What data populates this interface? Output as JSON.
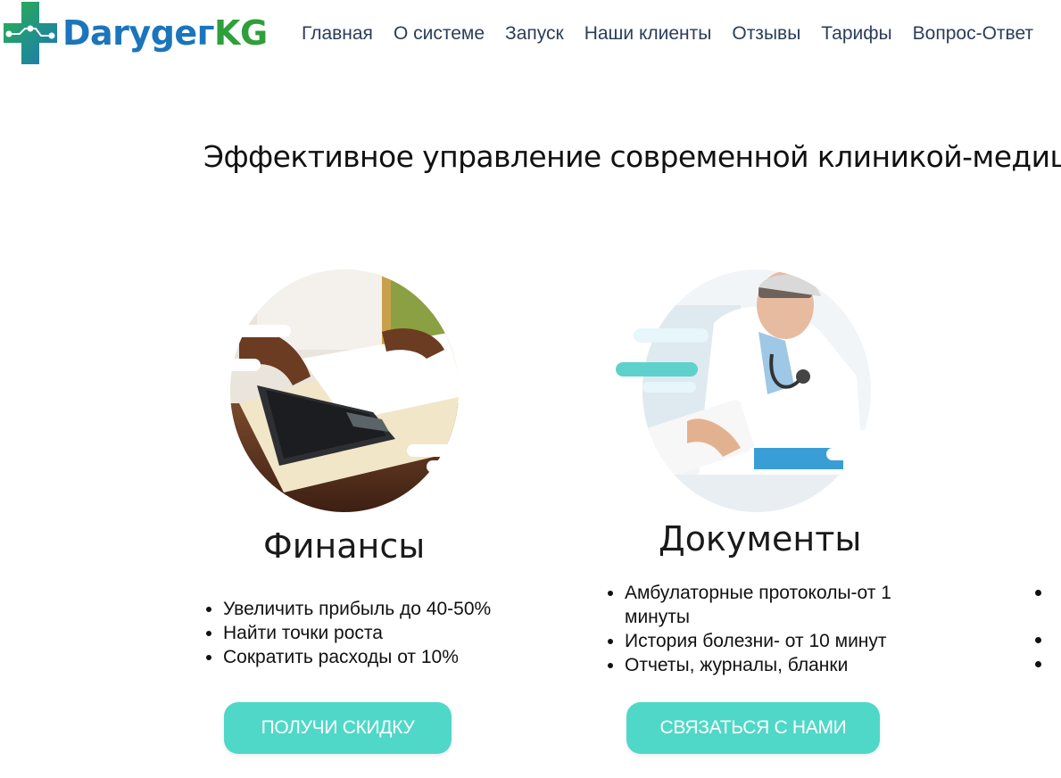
{
  "logo": {
    "text_part1": "Darygeг",
    "text_part2": "KG",
    "colors": {
      "primary": "#1b75bc",
      "secondary": "#2e9f3a",
      "cross": "#22a84a"
    }
  },
  "nav": {
    "items": [
      {
        "label": "Главная"
      },
      {
        "label": "О системе"
      },
      {
        "label": "Запуск"
      },
      {
        "label": "Наши клиенты"
      },
      {
        "label": "Отзывы"
      },
      {
        "label": "Тарифы"
      },
      {
        "label": "Вопрос-Ответ"
      }
    ]
  },
  "hero": {
    "headline": "Эффективное управление современной клиникой-медицин"
  },
  "cards": [
    {
      "title": "Финансы",
      "image_icon": "calculator-photo",
      "bullets": [
        "Увеличить прибыль до 40-50%",
        "Найти точки роста",
        "Сократить расходы от 10%"
      ],
      "button": "ПОЛУЧИ СКИДКУ"
    },
    {
      "title": "Документы",
      "image_icon": "doctor-photo",
      "bullets": [
        "Амбулаторные протоколы-от 1 минуты",
        "История болезни- от 10 минут",
        "Отчеты, журналы, бланки"
      ],
      "button": "СВЯЗАТЬСЯ С НАМИ"
    }
  ],
  "theme": {
    "accent": "#4fd8c8",
    "nav_text": "#2b3d59"
  }
}
